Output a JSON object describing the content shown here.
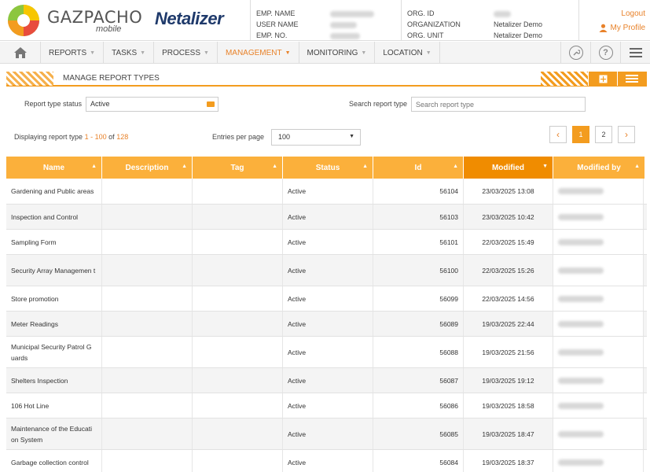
{
  "brand": {
    "name": "GAZPACHO",
    "sub": "mobile",
    "partner": "Netalizer"
  },
  "header": {
    "emp_name_label": "EMP. NAME",
    "user_name_label": "USER NAME",
    "emp_no_label": "EMP. NO.",
    "org_id_label": "ORG. ID",
    "organization_label": "ORGANIZATION",
    "org_unit_label": "ORG. UNIT",
    "organization_value": "Netalizer Demo",
    "org_unit_value": "Netalizer Demo",
    "logout": "Logout",
    "my_profile": "My Profile"
  },
  "nav": {
    "items": [
      {
        "label": "REPORTS"
      },
      {
        "label": "TASKS"
      },
      {
        "label": "PROCESS"
      },
      {
        "label": "MANAGEMENT"
      },
      {
        "label": "MONITORING"
      },
      {
        "label": "LOCATION"
      }
    ],
    "active": "MANAGEMENT"
  },
  "panel": {
    "title": "MANAGE REPORT TYPES"
  },
  "filters": {
    "status_label": "Report type status",
    "status_value": "Active",
    "search_label": "Search report type",
    "search_placeholder": "Search report type"
  },
  "listing": {
    "display_prefix": "Displaying report type",
    "from": "1",
    "dash": "-",
    "to": "100",
    "of": "of",
    "total": "128",
    "entries_label": "Entries per page",
    "entries_value": "100"
  },
  "pagination": {
    "prev": "‹",
    "pages": [
      "1",
      "2"
    ],
    "current": "1",
    "next": "›"
  },
  "table": {
    "columns": [
      "Name",
      "Description",
      "Tag",
      "Status",
      "Id",
      "Modified",
      "Modified by"
    ],
    "sorted_column": "Modified",
    "rows": [
      {
        "name": "Gardening and Public areas",
        "status": "Active",
        "id": "56104",
        "modified": "23/03/2025 13:08"
      },
      {
        "name": "Inspection and Control",
        "status": "Active",
        "id": "56103",
        "modified": "23/03/2025 10:42"
      },
      {
        "name": "Sampling Form",
        "status": "Active",
        "id": "56101",
        "modified": "22/03/2025 15:49"
      },
      {
        "name": "Security Array Managemen t",
        "status": "Active",
        "id": "56100",
        "modified": "22/03/2025 15:26"
      },
      {
        "name": "Store promotion",
        "status": "Active",
        "id": "56099",
        "modified": "22/03/2025 14:56"
      },
      {
        "name": "Meter Readings",
        "status": "Active",
        "id": "56089",
        "modified": "19/03/2025 22:44"
      },
      {
        "name": "Municipal Security Patrol G uards",
        "status": "Active",
        "id": "56088",
        "modified": "19/03/2025 21:56"
      },
      {
        "name": "Shelters Inspection",
        "status": "Active",
        "id": "56087",
        "modified": "19/03/2025 19:12"
      },
      {
        "name": "106 Hot Line",
        "status": "Active",
        "id": "56086",
        "modified": "19/03/2025 18:58"
      },
      {
        "name": "Maintenance of the Educati on System",
        "status": "Active",
        "id": "56085",
        "modified": "19/03/2025 18:47"
      },
      {
        "name": "Garbage collection control",
        "status": "Active",
        "id": "56084",
        "modified": "19/03/2025 18:37"
      }
    ]
  },
  "colors": {
    "accent": "#f39c1f",
    "header_cell": "#fbb03b",
    "sorted_header": "#f08c00",
    "link": "#e8822a"
  }
}
